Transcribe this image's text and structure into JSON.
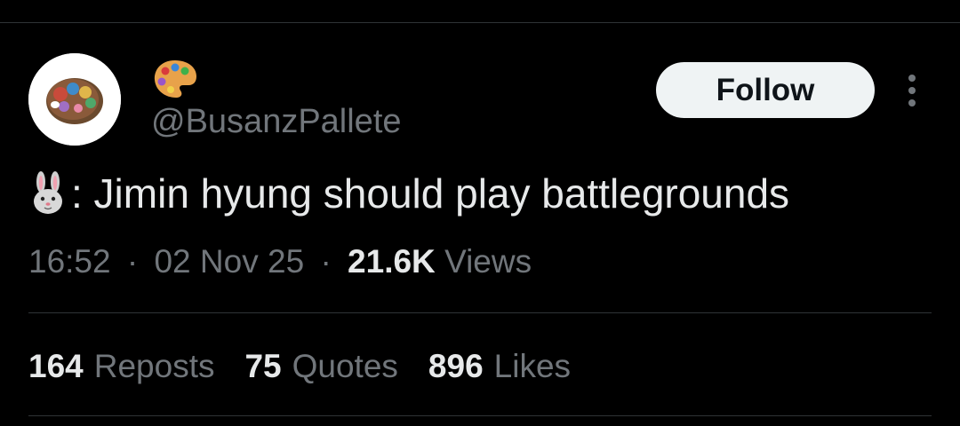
{
  "user": {
    "handle": "@BusanzPallete",
    "display_name_icon": "artist-palette-icon",
    "avatar_icon": "paint-palette-avatar"
  },
  "header": {
    "follow_label": "Follow",
    "more_icon": "more-options-icon"
  },
  "tweet": {
    "prefix_icon": "rabbit-face-icon",
    "text": ": Jimin hyung should play battlegrounds"
  },
  "meta": {
    "time": "16:52",
    "separator": "·",
    "date": "02 Nov 25",
    "views_count": "21.6K",
    "views_label": "Views"
  },
  "stats": {
    "reposts_count": "164",
    "reposts_label": "Reposts",
    "quotes_count": "75",
    "quotes_label": "Quotes",
    "likes_count": "896",
    "likes_label": "Likes"
  },
  "colors": {
    "background": "#000000",
    "primary_text": "#e7e9ea",
    "secondary_text": "#71767b",
    "divider": "#2f3336",
    "follow_button_bg": "#eff3f4"
  }
}
